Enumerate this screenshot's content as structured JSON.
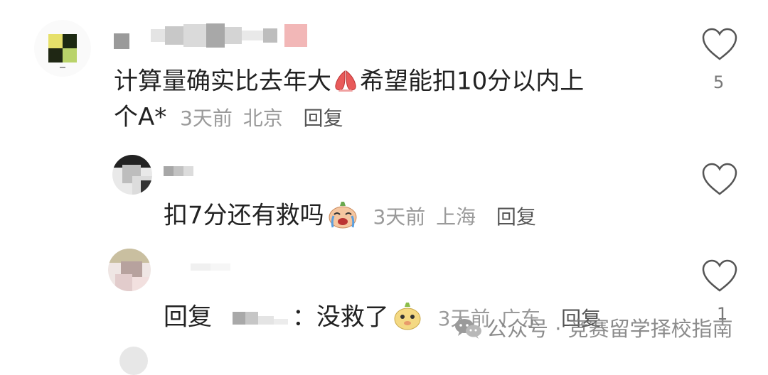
{
  "comments": [
    {
      "text": "计算量确实比去年大",
      "text_cont": "希望能扣10分以内上",
      "text_line2": "个A*",
      "time": "3天前",
      "location": "北京",
      "reply_label": "回复",
      "like_count": "5"
    },
    {
      "text": "扣7分还有救吗",
      "time": "3天前",
      "location": "上海",
      "reply_label": "回复",
      "like_count": ""
    },
    {
      "prefix": "回复",
      "separator": "：",
      "text": "没救了",
      "time": "3天前",
      "location": "广东",
      "reply_label": "回复",
      "like_count": "1"
    }
  ],
  "watermark": {
    "text": "公众号 · 竞赛留学择校指南",
    "icon": "wechat-icon"
  },
  "icons": {
    "like": "heart-outline-icon",
    "emoji_1": "praying-hands-icon",
    "emoji_2": "crying-face-icon",
    "emoji_3": "sheep-face-icon"
  },
  "colors": {
    "meta_text": "#9a9a9a",
    "heart_stroke": "#555555"
  }
}
